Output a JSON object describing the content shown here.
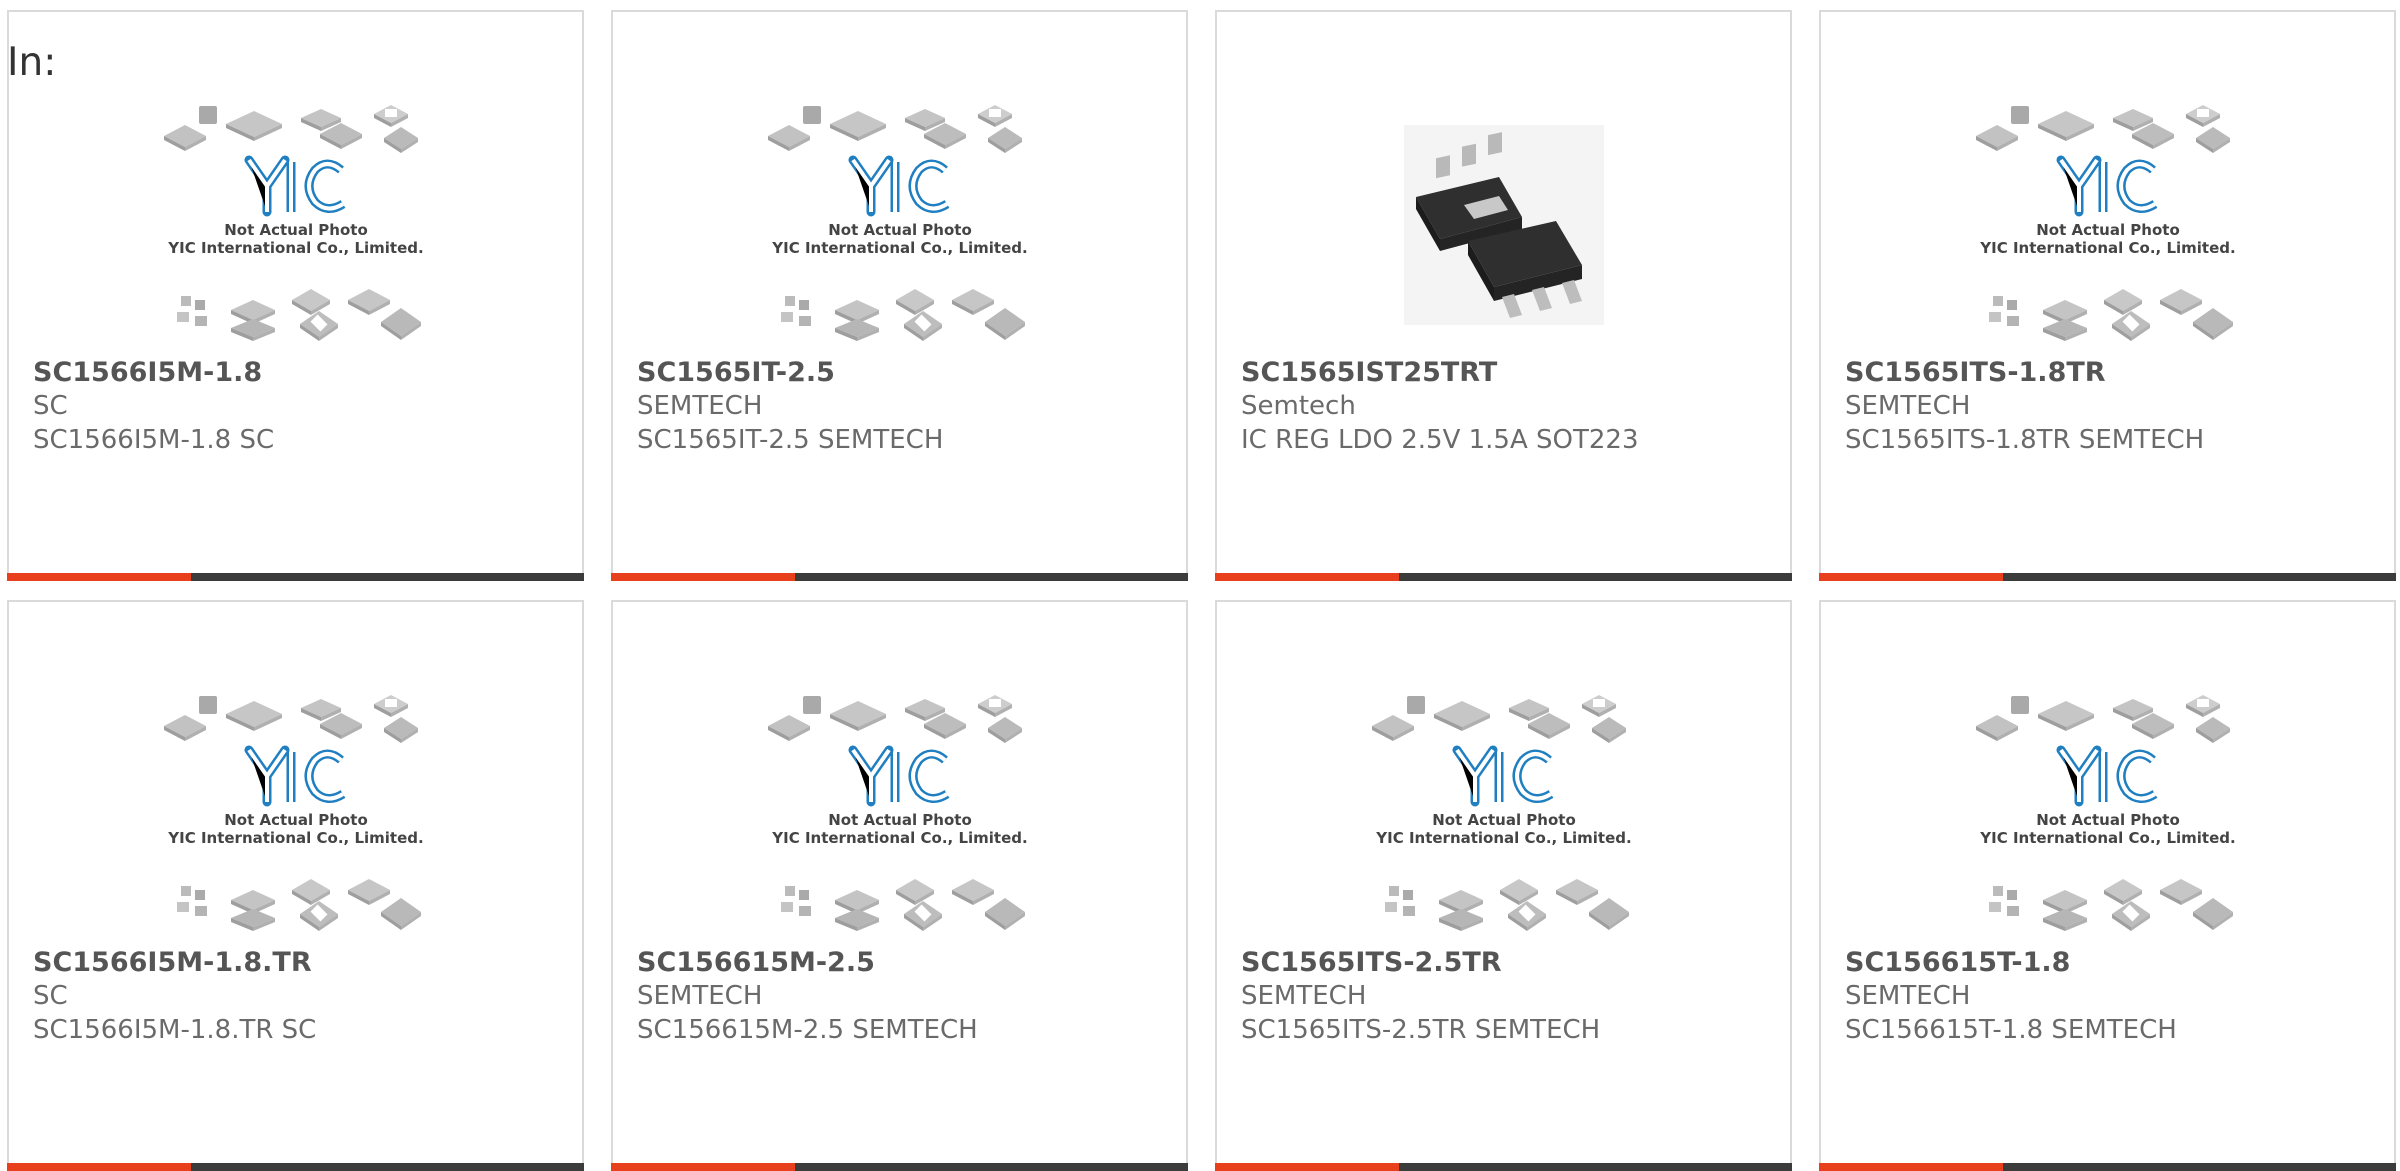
{
  "header": {
    "in_label": "In:"
  },
  "placeholder": {
    "line1": "Not Actual Photo",
    "line2": "YIC International Co., Limited.",
    "logo": "YIC"
  },
  "colors": {
    "accent": "#e8401c",
    "bar": "#3c3c3c",
    "logo_blue": "#1f7fc1"
  },
  "products": [
    {
      "part": "SC1566I5M-1.8",
      "manufacturer": "SC",
      "description": "SC1566I5M-1.8 SC",
      "image": "placeholder"
    },
    {
      "part": "SC1565IT-2.5",
      "manufacturer": "SEMTECH",
      "description": "SC1565IT-2.5 SEMTECH",
      "image": "placeholder"
    },
    {
      "part": "SC1565IST25TRT",
      "manufacturer": "Semtech",
      "description": "IC REG LDO 2.5V 1.5A SOT223",
      "image": "sot223-photo"
    },
    {
      "part": "SC1565ITS-1.8TR",
      "manufacturer": "SEMTECH",
      "description": "SC1565ITS-1.8TR SEMTECH",
      "image": "placeholder"
    },
    {
      "part": "SC1566I5M-1.8.TR",
      "manufacturer": "SC",
      "description": "SC1566I5M-1.8.TR SC",
      "image": "placeholder"
    },
    {
      "part": "SC156615M-2.5",
      "manufacturer": "SEMTECH",
      "description": "SC156615M-2.5 SEMTECH",
      "image": "placeholder"
    },
    {
      "part": "SC1565ITS-2.5TR",
      "manufacturer": "SEMTECH",
      "description": "SC1565ITS-2.5TR SEMTECH",
      "image": "placeholder"
    },
    {
      "part": "SC156615T-1.8",
      "manufacturer": "SEMTECH",
      "description": "SC156615T-1.8 SEMTECH",
      "image": "placeholder"
    }
  ]
}
